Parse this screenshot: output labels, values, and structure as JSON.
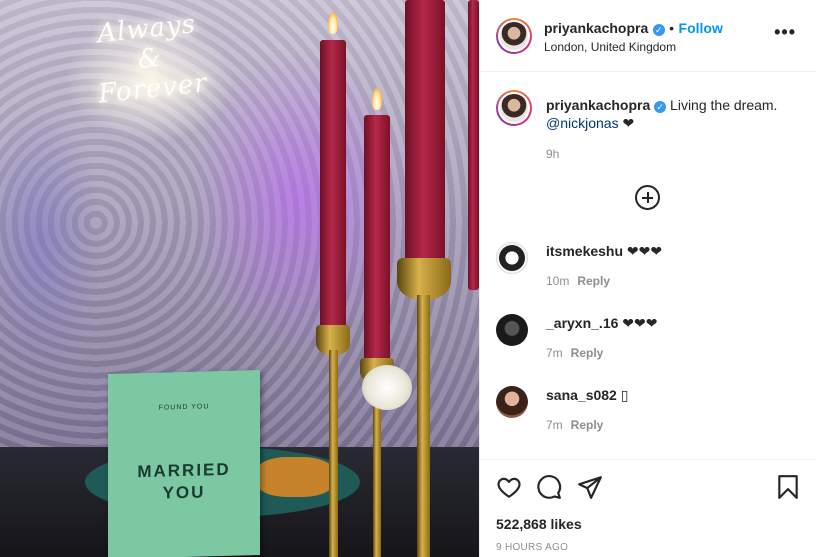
{
  "post": {
    "photo": {
      "neon_line1": "Always",
      "neon_line2": "&",
      "neon_line3": "Forever",
      "card_small": "FOUND YOU",
      "card_line1": "MARRIED",
      "card_line2": "YOU"
    },
    "header": {
      "username": "priyankachopra",
      "verified_icon": "verified-badge-icon",
      "separator": "•",
      "follow_label": "Follow",
      "location": "London, United Kingdom",
      "more_label": "•••"
    },
    "caption": {
      "username": "priyankachopra",
      "text": " Living the dream. ",
      "mention": "@nickjonas",
      "heart": " ❤",
      "time": "9h"
    },
    "load_more_icon": "plus-circle-icon",
    "comments": [
      {
        "username": "itsmekeshu",
        "text": " ❤❤❤",
        "time": "10m",
        "reply": "Reply"
      },
      {
        "username": "_aryxn_.16",
        "text": " ❤❤❤",
        "time": "7m",
        "reply": "Reply"
      },
      {
        "username": "sana_s082",
        "text": " ▯",
        "time": "7m",
        "reply": "Reply"
      }
    ],
    "actions": {
      "like_icon": "heart-icon",
      "comment_icon": "comment-icon",
      "share_icon": "paper-plane-icon",
      "save_icon": "bookmark-icon",
      "likes": "522,868 likes",
      "posted": "9 HOURS AGO"
    },
    "colors": {
      "link": "#0095f6",
      "mention": "#00376b",
      "muted": "#8e8e8e",
      "text": "#262626"
    }
  }
}
